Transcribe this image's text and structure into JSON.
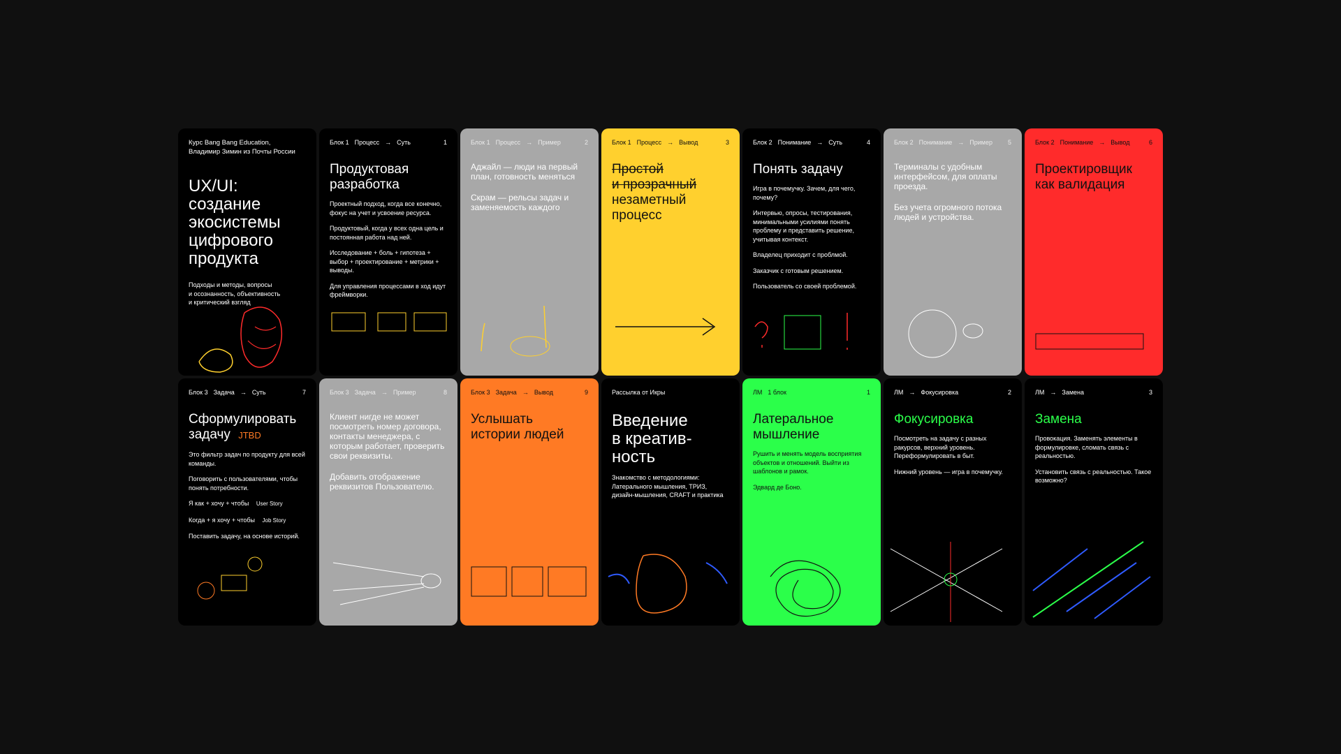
{
  "cards": [
    {
      "intro": [
        "Курс Bang Bang Education,",
        "Владимир Зимин из Почты России"
      ],
      "title": [
        "UX/UI:",
        "создание",
        "экосистемы",
        "цифрового",
        "продукта"
      ],
      "sub": [
        "Подходы и методы, вопросы",
        "и осознанность, объективность",
        "и критический взгляд"
      ]
    },
    {
      "head": [
        "Блок 1",
        "Процесс",
        "Суть",
        "1"
      ],
      "title": [
        "Продуктовая",
        "разработка"
      ],
      "paras": [
        "Проектный подход, когда все конечно, фокус на учет и усвоение ресурса.",
        "Продуктовый, когда у всех одна цель и постоянная работа над ней.",
        "Исследование + боль + гипотеза + выбор + проектирование + метрики + выводы.",
        "Для управления процессами в ход идут фреймворки."
      ]
    },
    {
      "head": [
        "Блок 1",
        "Процесс",
        "Пример",
        "2"
      ],
      "paras": [
        "Аджайл — люди на первый план, готовность меняться",
        "Скрам — рельсы задач и заменяемость каждого"
      ]
    },
    {
      "head": [
        "Блок 1",
        "Процесс",
        "Вывод",
        "3"
      ],
      "title": [
        "Простой",
        "и прозрачный",
        "незаметный",
        "процесс"
      ]
    },
    {
      "head": [
        "Блок 2",
        "Понимание",
        "Суть",
        "4"
      ],
      "title": [
        "Понять задачу"
      ],
      "paras": [
        "Игра в почемучку. Зачем, для чего, почему?",
        "Интервью, опросы, тестирования, минимальными усилиями понять проблему и представить решение, учитывая контекст.",
        "Владелец приходит с проблмой.",
        "Заказчик с готовым решением.",
        "Пользователь со своей проблемой."
      ]
    },
    {
      "head": [
        "Блок 2",
        "Понимание",
        "Пример",
        "5"
      ],
      "paras": [
        "Терминалы с удобным интерфейсом, для оплаты проезда.",
        "Без учета огромного потока людей и устройства."
      ]
    },
    {
      "head": [
        "Блок 2",
        "Понимание",
        "Вывод",
        "6"
      ],
      "title": [
        "Проектировщик",
        "как валидация"
      ]
    },
    {
      "head": [
        "Блок 3",
        "Задача",
        "Суть",
        "7"
      ],
      "title": [
        "Сформулировать",
        "задачу"
      ],
      "paras": [
        "Это фильтр задач по продукту для всей команды.",
        "Поговорить с пользователями, чтобы понять потребности.",
        "Я как + хочу + чтобы",
        "Когда + я хочу + чтобы",
        "Поставить задачу, на основе историй."
      ],
      "notes": [
        "JTBD",
        "User Story",
        "Job Story"
      ]
    },
    {
      "head": [
        "Блок 3",
        "Задача",
        "Пример",
        "8"
      ],
      "paras": [
        "Клиент нигде не может посмотреть номер договора, контакты менеджера, с которым работает, проверить свои реквизиты.",
        "Добавить отображение реквизитов Пользователю."
      ]
    },
    {
      "head": [
        "Блок 3",
        "Задача",
        "Вывод",
        "9"
      ],
      "title": [
        "Услышать",
        "истории людей"
      ]
    },
    {
      "head": [
        "Рассылка от Икры"
      ],
      "title": [
        "Введение",
        "в креатив-",
        "ность"
      ],
      "paras": [
        "Знакомство с методологиями: Латерального мышления, ТРИЗ, дизайн-мышления, CRAFT и практика"
      ]
    },
    {
      "head": [
        "ЛМ",
        "1 блок",
        "1"
      ],
      "title": [
        "Латеральное",
        "мышление"
      ],
      "paras": [
        "Рушить и менять модель восприятия объектов и отношений. Выйти из шаблонов и рамок.",
        "Эдвард де Боно."
      ]
    },
    {
      "head": [
        "ЛМ",
        "Фокусировка",
        "2"
      ],
      "title": [
        "Фокусировка"
      ],
      "paras": [
        "Посмотреть на задачу с разных ракурсов, верхний уровень. Переформулировать в быт.",
        "Нижний уровень — игра в почемучку."
      ]
    },
    {
      "head": [
        "ЛМ",
        "Замена",
        "3"
      ],
      "title": [
        "Замена"
      ],
      "paras": [
        "Провокация. Заменять элементы в формулировке, сломать связь с реальностью.",
        "Установить связь с реальностью. Такое возможно?"
      ]
    }
  ],
  "colors": {
    "dark": "#000000",
    "grey": "#a8a8a8",
    "yellow": "#ffd02e",
    "red": "#ff2b2b",
    "orange": "#ff7a24",
    "green": "#2bff4a"
  }
}
